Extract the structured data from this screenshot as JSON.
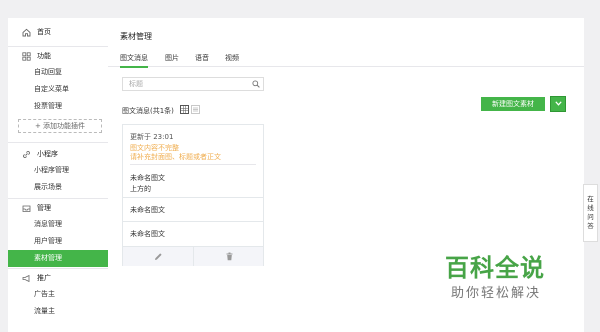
{
  "sidebar": {
    "home": "首页",
    "functions": {
      "header": "功能",
      "items": [
        "自动回复",
        "自定义菜单",
        "投票管理"
      ]
    },
    "add_plugin": "+ 添加功能插件",
    "miniprogram": {
      "header": "小程序",
      "items": [
        "小程序管理",
        "展示场景"
      ]
    },
    "manage": {
      "header": "管理",
      "items": [
        "消息管理",
        "用户管理",
        "素材管理"
      ],
      "active_index": 2
    },
    "promote": {
      "header": "推广",
      "items": [
        "广告主",
        "流量主"
      ]
    }
  },
  "main": {
    "title": "素材管理",
    "tabs": [
      "图文消息",
      "图片",
      "语音",
      "视频"
    ],
    "active_tab": 0,
    "search_placeholder": "标题",
    "count_label": "图文消息(共1条)",
    "new_button": "新建图文素材",
    "card": {
      "updated": "更新于 23:01",
      "warning_line1": "图文内容不完整",
      "warning_line2": "请补充封面图、标题或者正文",
      "items": [
        {
          "title": "未命名图文",
          "subtitle": "上方的"
        },
        {
          "title": "未命名图文"
        },
        {
          "title": "未命名图文"
        }
      ]
    }
  },
  "float_panel": [
    "在",
    "线",
    "问",
    "答"
  ],
  "watermark": {
    "title": "百科全说",
    "subtitle": "助你轻松解决"
  },
  "colors": {
    "accent": "#44b549",
    "warning": "#f0ad4e",
    "background": "#f0f0f2"
  }
}
